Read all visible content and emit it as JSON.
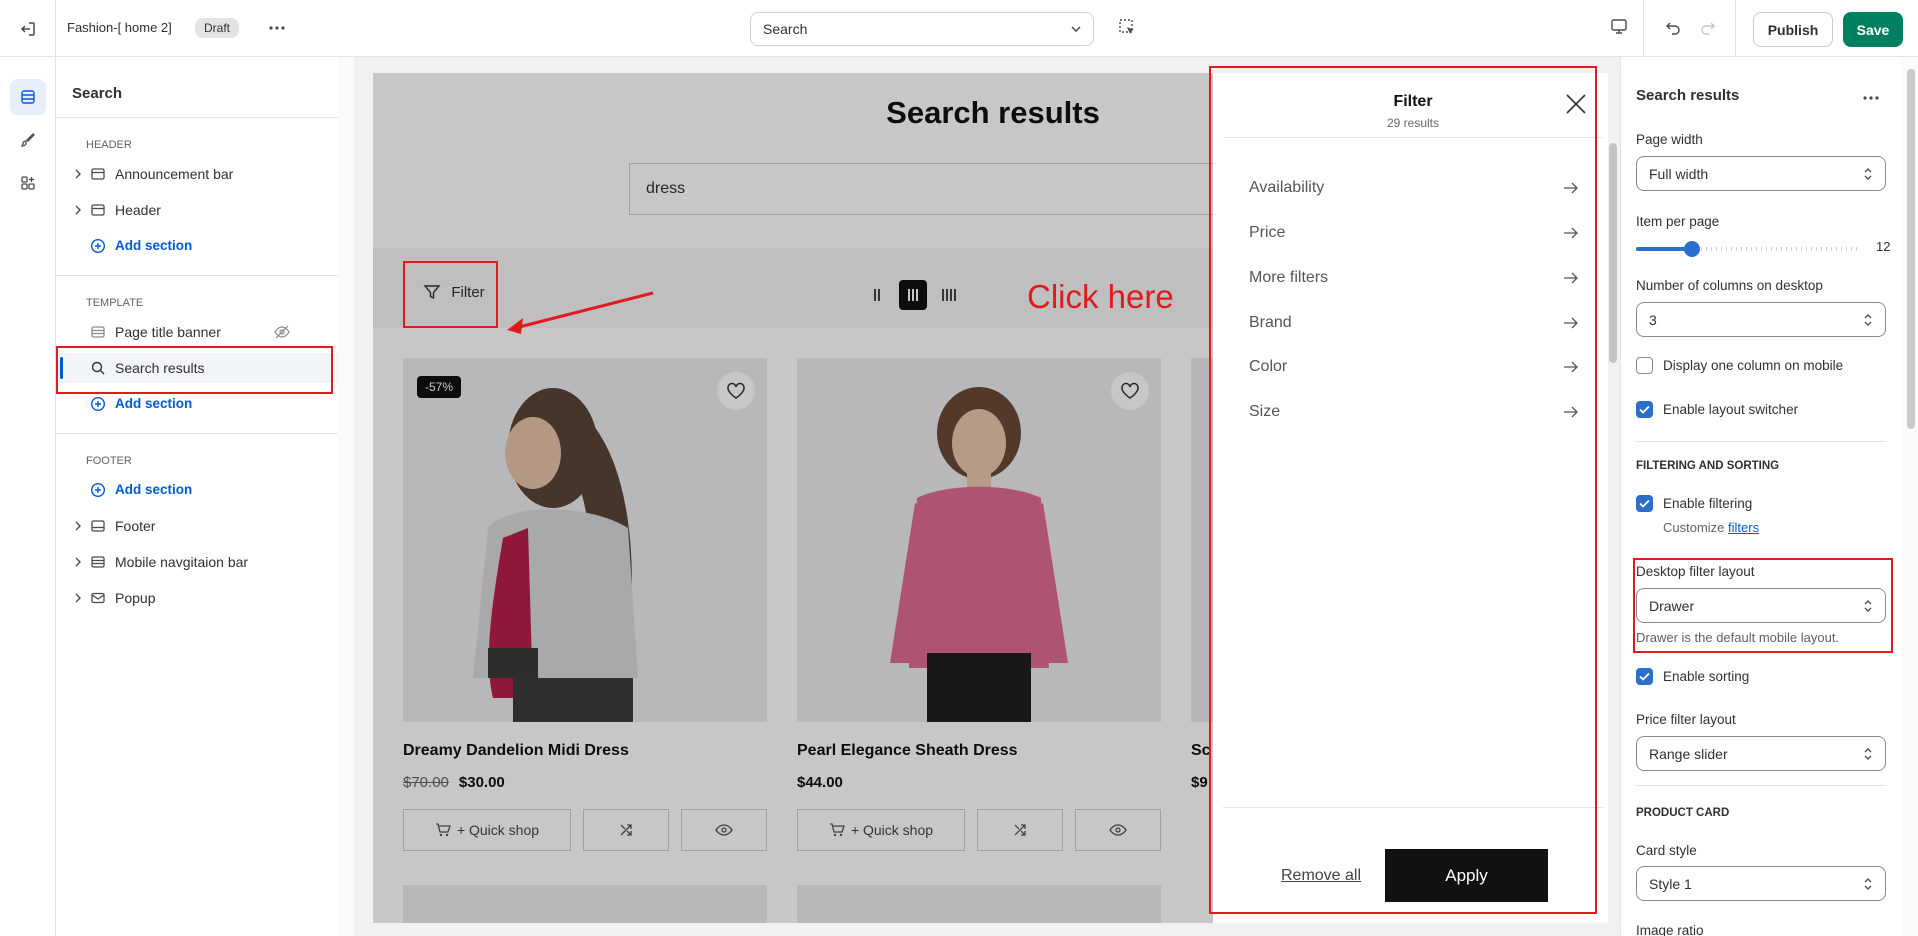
{
  "topbar": {
    "theme_name": "Fashion-[ home 2]",
    "status_badge": "Draft",
    "page_selector": "Search",
    "publish_label": "Publish",
    "save_label": "Save"
  },
  "sidebar": {
    "title": "Search",
    "header_group": "HEADER",
    "header_items": [
      "Announcement bar",
      "Header"
    ],
    "add_section": "Add section",
    "template_group": "TEMPLATE",
    "template_items": [
      "Page title banner",
      "Search results"
    ],
    "footer_group": "FOOTER",
    "footer_items": [
      "Footer",
      "Mobile navgitaion bar",
      "Popup"
    ]
  },
  "preview": {
    "title": "Search results",
    "search_value": "dress",
    "filter_label": "Filter",
    "annotation": "Click here",
    "products": [
      {
        "name": "Dreamy Dandelion Midi Dress",
        "old_price": "$70.00",
        "price": "$30.00",
        "badge": "-57%",
        "quick_shop": "+ Quick shop"
      },
      {
        "name": "Pearl Elegance Sheath Dress",
        "old_price": "",
        "price": "$44.00",
        "badge": "",
        "quick_shop": "+ Quick shop"
      },
      {
        "name": "Sc",
        "old_price": "$9",
        "price": "",
        "badge": "",
        "quick_shop": ""
      }
    ]
  },
  "drawer": {
    "title": "Filter",
    "subtitle": "29 results",
    "items": [
      "Availability",
      "Price",
      "More filters",
      "Brand",
      "Color",
      "Size"
    ],
    "remove_all": "Remove all",
    "apply": "Apply"
  },
  "settings": {
    "title": "Search results",
    "page_width_label": "Page width",
    "page_width_value": "Full width",
    "items_per_page_label": "Item per page",
    "items_per_page_value": "12",
    "items_per_page_fraction": 0.25,
    "columns_label": "Number of columns on desktop",
    "columns_value": "3",
    "one_column_mobile": "Display one column on mobile",
    "layout_switcher": "Enable layout switcher",
    "filtering_heading": "FILTERING AND SORTING",
    "enable_filtering": "Enable filtering",
    "customize_text": "Customize",
    "filters_link": "filters",
    "desktop_filter_label": "Desktop filter layout",
    "desktop_filter_value": "Drawer",
    "desktop_filter_help": "Drawer is the default mobile layout.",
    "enable_sorting": "Enable sorting",
    "price_filter_label": "Price filter layout",
    "price_filter_value": "Range slider",
    "product_card_heading": "PRODUCT CARD",
    "card_style_label": "Card style",
    "card_style_value": "Style 1",
    "image_ratio_label": "Image ratio"
  },
  "colors": {
    "accent": "#005bd3",
    "save": "#008060",
    "annotation": "#e01b1b"
  }
}
